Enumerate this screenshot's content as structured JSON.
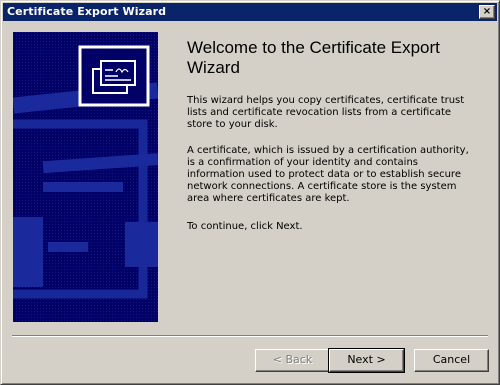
{
  "window": {
    "title": "Certificate Export Wizard",
    "close_symbol": "×"
  },
  "banner": {
    "icon": "certificate-icon",
    "colors": {
      "background": "#000066",
      "pattern": "#1a2a9c",
      "icon_frame": "#ffffff"
    }
  },
  "content": {
    "heading": "Welcome to the Certificate Export Wizard",
    "paragraph1": "This wizard helps you copy certificates, certificate trust lists and certificate revocation lists from a certificate store to your disk.",
    "paragraph2": "A certificate, which is issued by a certification authority, is a confirmation of your identity and contains information used to protect data or to establish secure network connections. A certificate store is the system area where certificates are kept.",
    "paragraph3": "To continue, click Next."
  },
  "buttons": {
    "back": {
      "label": "< Back",
      "enabled": false
    },
    "next": {
      "label": "Next >",
      "enabled": true,
      "default": true
    },
    "cancel": {
      "label": "Cancel",
      "enabled": true
    }
  },
  "colors": {
    "titlebar": "#0a246a",
    "dialog": "#d4d0c8"
  }
}
